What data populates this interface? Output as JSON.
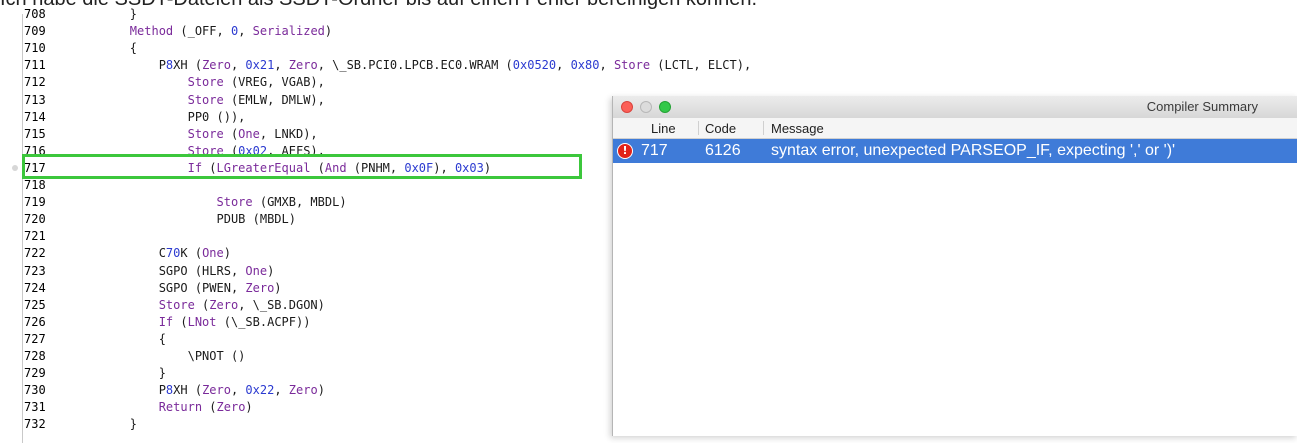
{
  "top_text": "Ich habe die SSDT-Dateien als SSDT-Ordner bis auf einen Fehler bereinigen können.",
  "editor": {
    "lines": [
      {
        "num": "708",
        "code": "        }"
      },
      {
        "num": "709",
        "code": "        Method (_OFF, 0, Serialized)"
      },
      {
        "num": "710",
        "code": "        {"
      },
      {
        "num": "711",
        "code": "            P8XH (Zero, 0x21, Zero, \\_SB.PCI0.LPCB.EC0.WRAM (0x0520, 0x80, Store (LCTL, ELCT),"
      },
      {
        "num": "712",
        "code": "                Store (VREG, VGAB),"
      },
      {
        "num": "713",
        "code": "                Store (EMLW, DMLW),"
      },
      {
        "num": "714",
        "code": "                PP0 ()),"
      },
      {
        "num": "715",
        "code": "                Store (One, LNKD),"
      },
      {
        "num": "716",
        "code": "                Store (0x02, AEFS),"
      },
      {
        "num": "717",
        "code": "                If (LGreaterEqual (And (PNHM, 0x0F), 0x03)"
      },
      {
        "num": "718",
        "code": ""
      },
      {
        "num": "719",
        "code": "                    Store (GMXB, MBDL)"
      },
      {
        "num": "720",
        "code": "                    PDUB (MBDL)"
      },
      {
        "num": "721",
        "code": ""
      },
      {
        "num": "722",
        "code": "            C70K (One)"
      },
      {
        "num": "723",
        "code": "            SGPO (HLRS, One)"
      },
      {
        "num": "724",
        "code": "            SGPO (PWEN, Zero)"
      },
      {
        "num": "725",
        "code": "            Store (Zero, \\_SB.DGON)"
      },
      {
        "num": "726",
        "code": "            If (LNot (\\_SB.ACPF))"
      },
      {
        "num": "727",
        "code": "            {"
      },
      {
        "num": "728",
        "code": "                \\PNOT ()"
      },
      {
        "num": "729",
        "code": "            }"
      },
      {
        "num": "730",
        "code": "            P8XH (Zero, 0x22, Zero)"
      },
      {
        "num": "731",
        "code": "            Return (Zero)"
      },
      {
        "num": "732",
        "code": "        }"
      }
    ]
  },
  "summary": {
    "title": "Compiler Summary",
    "columns": {
      "line": "Line",
      "code": "Code",
      "message": "Message"
    },
    "rows": [
      {
        "icon": "error-icon",
        "line": "717",
        "code": "6126",
        "message": "syntax error, unexpected PARSEOP_IF, expecting ',' or ')'"
      }
    ]
  },
  "colors": {
    "highlight": "#3cc73c",
    "selection": "#3f7bd8",
    "error": "#e2231a"
  }
}
